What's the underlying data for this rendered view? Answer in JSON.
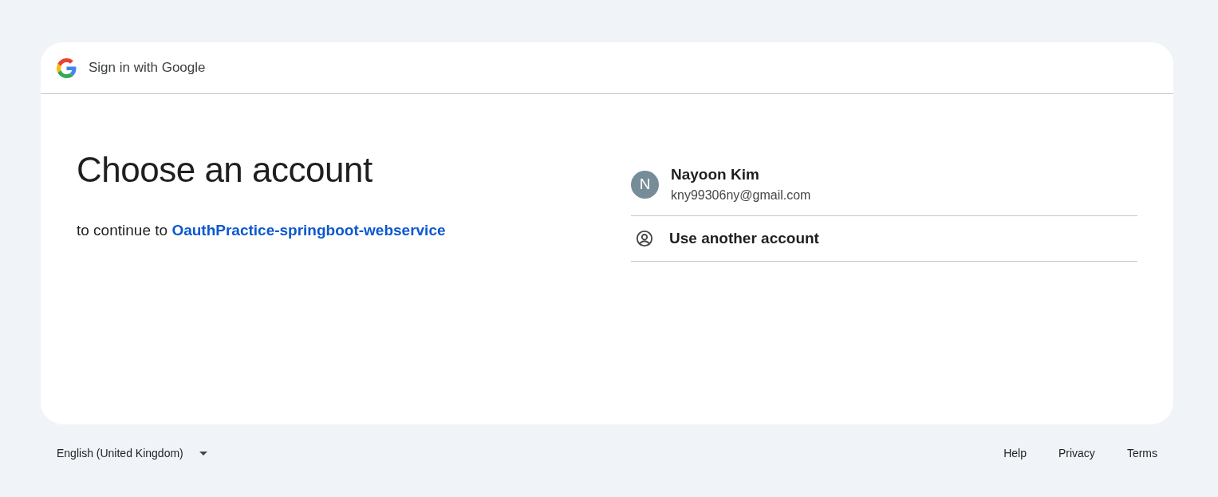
{
  "header": {
    "title": "Sign in with Google"
  },
  "heading": "Choose an account",
  "subtitle": {
    "text": "to continue to",
    "link": "OauthPractice-springboot-webservice"
  },
  "accounts": [
    {
      "kind": "account",
      "initial": "N",
      "name": "Nayoon Kim",
      "email": "kny99306ny@gmail.com"
    },
    {
      "kind": "other",
      "label": "Use another account"
    }
  ],
  "footer": {
    "language": "English (United Kingdom)",
    "links": [
      "Help",
      "Privacy",
      "Terms"
    ]
  }
}
